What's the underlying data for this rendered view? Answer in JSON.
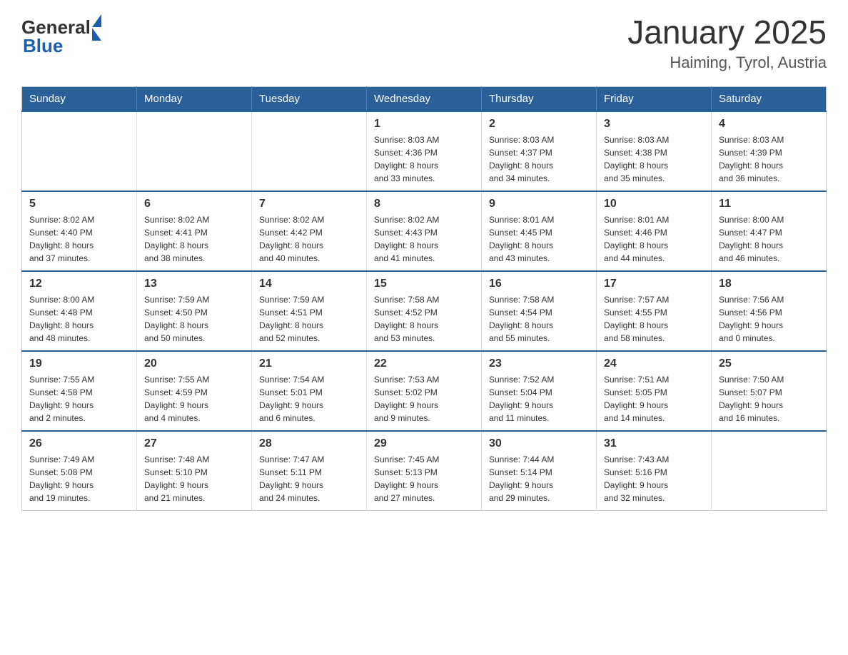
{
  "header": {
    "logo": {
      "general": "General",
      "blue": "Blue"
    },
    "title": "January 2025",
    "subtitle": "Haiming, Tyrol, Austria"
  },
  "days_of_week": [
    "Sunday",
    "Monday",
    "Tuesday",
    "Wednesday",
    "Thursday",
    "Friday",
    "Saturday"
  ],
  "weeks": [
    [
      {
        "day": "",
        "info": ""
      },
      {
        "day": "",
        "info": ""
      },
      {
        "day": "",
        "info": ""
      },
      {
        "day": "1",
        "info": "Sunrise: 8:03 AM\nSunset: 4:36 PM\nDaylight: 8 hours\nand 33 minutes."
      },
      {
        "day": "2",
        "info": "Sunrise: 8:03 AM\nSunset: 4:37 PM\nDaylight: 8 hours\nand 34 minutes."
      },
      {
        "day": "3",
        "info": "Sunrise: 8:03 AM\nSunset: 4:38 PM\nDaylight: 8 hours\nand 35 minutes."
      },
      {
        "day": "4",
        "info": "Sunrise: 8:03 AM\nSunset: 4:39 PM\nDaylight: 8 hours\nand 36 minutes."
      }
    ],
    [
      {
        "day": "5",
        "info": "Sunrise: 8:02 AM\nSunset: 4:40 PM\nDaylight: 8 hours\nand 37 minutes."
      },
      {
        "day": "6",
        "info": "Sunrise: 8:02 AM\nSunset: 4:41 PM\nDaylight: 8 hours\nand 38 minutes."
      },
      {
        "day": "7",
        "info": "Sunrise: 8:02 AM\nSunset: 4:42 PM\nDaylight: 8 hours\nand 40 minutes."
      },
      {
        "day": "8",
        "info": "Sunrise: 8:02 AM\nSunset: 4:43 PM\nDaylight: 8 hours\nand 41 minutes."
      },
      {
        "day": "9",
        "info": "Sunrise: 8:01 AM\nSunset: 4:45 PM\nDaylight: 8 hours\nand 43 minutes."
      },
      {
        "day": "10",
        "info": "Sunrise: 8:01 AM\nSunset: 4:46 PM\nDaylight: 8 hours\nand 44 minutes."
      },
      {
        "day": "11",
        "info": "Sunrise: 8:00 AM\nSunset: 4:47 PM\nDaylight: 8 hours\nand 46 minutes."
      }
    ],
    [
      {
        "day": "12",
        "info": "Sunrise: 8:00 AM\nSunset: 4:48 PM\nDaylight: 8 hours\nand 48 minutes."
      },
      {
        "day": "13",
        "info": "Sunrise: 7:59 AM\nSunset: 4:50 PM\nDaylight: 8 hours\nand 50 minutes."
      },
      {
        "day": "14",
        "info": "Sunrise: 7:59 AM\nSunset: 4:51 PM\nDaylight: 8 hours\nand 52 minutes."
      },
      {
        "day": "15",
        "info": "Sunrise: 7:58 AM\nSunset: 4:52 PM\nDaylight: 8 hours\nand 53 minutes."
      },
      {
        "day": "16",
        "info": "Sunrise: 7:58 AM\nSunset: 4:54 PM\nDaylight: 8 hours\nand 55 minutes."
      },
      {
        "day": "17",
        "info": "Sunrise: 7:57 AM\nSunset: 4:55 PM\nDaylight: 8 hours\nand 58 minutes."
      },
      {
        "day": "18",
        "info": "Sunrise: 7:56 AM\nSunset: 4:56 PM\nDaylight: 9 hours\nand 0 minutes."
      }
    ],
    [
      {
        "day": "19",
        "info": "Sunrise: 7:55 AM\nSunset: 4:58 PM\nDaylight: 9 hours\nand 2 minutes."
      },
      {
        "day": "20",
        "info": "Sunrise: 7:55 AM\nSunset: 4:59 PM\nDaylight: 9 hours\nand 4 minutes."
      },
      {
        "day": "21",
        "info": "Sunrise: 7:54 AM\nSunset: 5:01 PM\nDaylight: 9 hours\nand 6 minutes."
      },
      {
        "day": "22",
        "info": "Sunrise: 7:53 AM\nSunset: 5:02 PM\nDaylight: 9 hours\nand 9 minutes."
      },
      {
        "day": "23",
        "info": "Sunrise: 7:52 AM\nSunset: 5:04 PM\nDaylight: 9 hours\nand 11 minutes."
      },
      {
        "day": "24",
        "info": "Sunrise: 7:51 AM\nSunset: 5:05 PM\nDaylight: 9 hours\nand 14 minutes."
      },
      {
        "day": "25",
        "info": "Sunrise: 7:50 AM\nSunset: 5:07 PM\nDaylight: 9 hours\nand 16 minutes."
      }
    ],
    [
      {
        "day": "26",
        "info": "Sunrise: 7:49 AM\nSunset: 5:08 PM\nDaylight: 9 hours\nand 19 minutes."
      },
      {
        "day": "27",
        "info": "Sunrise: 7:48 AM\nSunset: 5:10 PM\nDaylight: 9 hours\nand 21 minutes."
      },
      {
        "day": "28",
        "info": "Sunrise: 7:47 AM\nSunset: 5:11 PM\nDaylight: 9 hours\nand 24 minutes."
      },
      {
        "day": "29",
        "info": "Sunrise: 7:45 AM\nSunset: 5:13 PM\nDaylight: 9 hours\nand 27 minutes."
      },
      {
        "day": "30",
        "info": "Sunrise: 7:44 AM\nSunset: 5:14 PM\nDaylight: 9 hours\nand 29 minutes."
      },
      {
        "day": "31",
        "info": "Sunrise: 7:43 AM\nSunset: 5:16 PM\nDaylight: 9 hours\nand 32 minutes."
      },
      {
        "day": "",
        "info": ""
      }
    ]
  ]
}
